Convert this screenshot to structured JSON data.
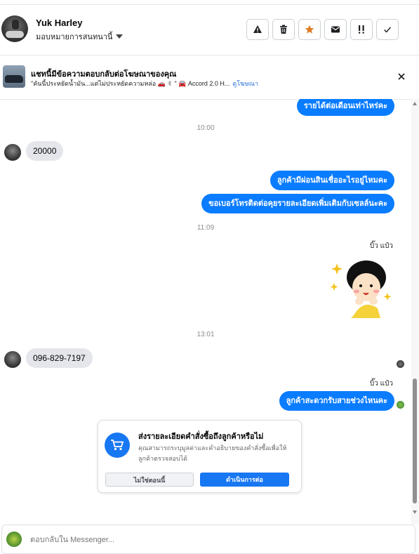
{
  "header": {
    "contact_name": "Yuk Harley",
    "assign_label": "มอบหมายการสนทนานี้",
    "actions": [
      "warning",
      "delete",
      "star",
      "mail",
      "important",
      "done"
    ],
    "colors": {
      "star": "#e07b24",
      "border": "#ccd0d5"
    }
  },
  "ad_banner": {
    "title": "แชทนี้มีข้อความตอบกลับต่อโฆษณาของคุณ",
    "snippet": "\"คันนี้ประหยัดน้ำมัน...แต่ไม่ประหยัดความหล่อ 🚗 ✌ \" 🚘 Accord 2.0 H...",
    "link": "ดูโฆษณา"
  },
  "messages": {
    "m1": "รายได้ต่อเดือนเท่าไหร่คะ",
    "t1": "10:00",
    "m2": "20000",
    "m3": "ลูกค้ามีผ่อนสินเชื่ออะไรอยู่ไหมคะ",
    "m4": "ขอเบอร์โทรติดต่อคุยรายละเอียดเพิ่มเติมกับเซลล์นะคะ",
    "t2": "11:09",
    "sender1": "บิ๊ว แป๋ว",
    "t3": "13:01",
    "m5": "096-829-7197",
    "sender2": "บิ๊ว แป๋ว",
    "m6": "ลูกค้าสะดวกรับสายช่วงไหนคะ"
  },
  "order_card": {
    "title": "ส่งรายละเอียดคำสั่งซื้อถึงลูกค้าหรือไม่",
    "description": "คุณสามารถระบุมูลค่าและคำอธิบายของคำสั่งซื้อเพื่อให้ลูกค้าตรวจสอบได้",
    "secondary_label": "ไม่ใช่ตอนนี้",
    "primary_label": "ดำเนินการต่อ"
  },
  "composer": {
    "placeholder": "ตอบกลับใน Messenger..."
  },
  "colors": {
    "outgoing": "#0a7cff",
    "incoming": "#e4e6eb",
    "primary": "#1877f2"
  }
}
